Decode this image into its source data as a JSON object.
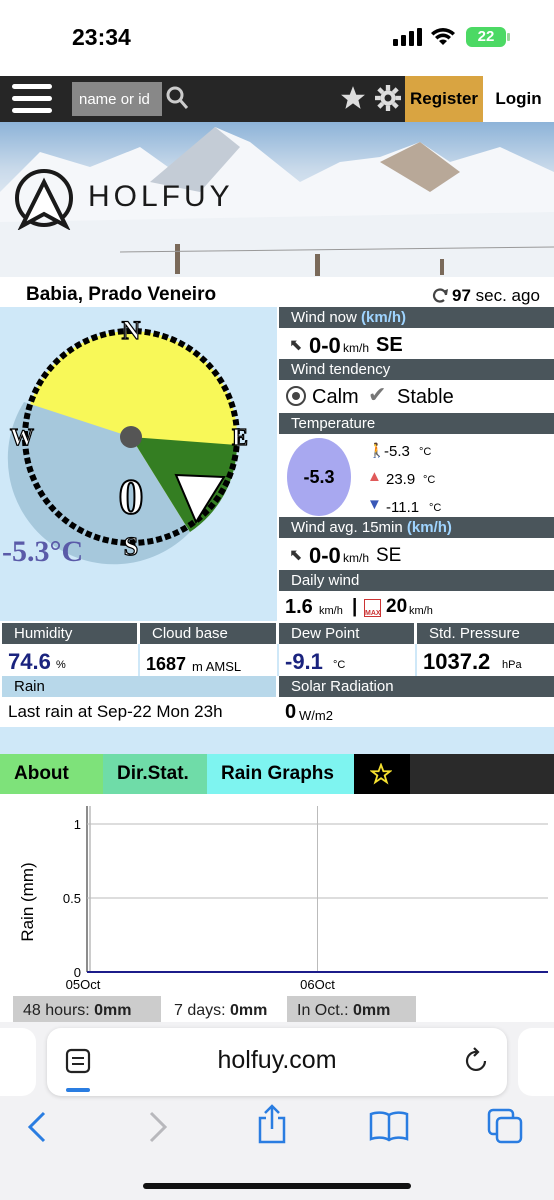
{
  "status": {
    "time": "23:34",
    "battery": "22"
  },
  "nav": {
    "search_placeholder": "name or id",
    "register_label": "Register",
    "login_label": "Login"
  },
  "banner": {
    "logo_text": "HOLFUY"
  },
  "station": {
    "name": "Babia, Prado Veneiro",
    "updated_value": "97",
    "updated_suffix": " sec. ago"
  },
  "compass": {
    "n": "N",
    "s": "S",
    "e": "E",
    "w": "W",
    "wind_value": "0",
    "temperature": "-5.3°C"
  },
  "wind_now": {
    "header": "Wind now ",
    "unit": "(km/h)",
    "value": "0-0",
    "unit_small": "km/h",
    "direction": "SE"
  },
  "wind_tendency": {
    "header": "Wind tendency",
    "calm_label": "Calm",
    "stable_label": "Stable"
  },
  "temperature": {
    "header": "Temperature",
    "current": "-5.3",
    "feels": "-5.3",
    "max": "23.9",
    "min": "-11.1",
    "unit": "°C"
  },
  "wind_avg": {
    "header": "Wind avg. 15min ",
    "unit": "(km/h)",
    "value": "0-0",
    "unit_small": "km/h",
    "direction": "SE"
  },
  "daily_wind": {
    "header": "Daily wind",
    "avg_value": "1.6",
    "avg_unit": "km/h",
    "separator": "|",
    "max_value": "20",
    "max_unit": "km/h",
    "max_badge": "MAX"
  },
  "humidity": {
    "header": "Humidity",
    "value": "74.6",
    "unit": "%"
  },
  "cloud_base": {
    "header": "Cloud base",
    "value": "1687",
    "unit": "m AMSL"
  },
  "dew_point": {
    "header": "Dew Point",
    "value": "-9.1",
    "unit": "°C"
  },
  "pressure": {
    "header": "Std. Pressure",
    "value": "1037.2",
    "unit": "hPa"
  },
  "rain": {
    "header": "Rain",
    "text": "Last rain at Sep-22 Mon 23h"
  },
  "solar": {
    "header": "Solar Radiation",
    "value": "0",
    "unit": "W/m2"
  },
  "tabs": {
    "about": "About",
    "dir_stat": "Dir.Stat.",
    "rain_graphs": "Rain Graphs"
  },
  "summary": {
    "h48_label": "48 hours: ",
    "h48_value": "0mm",
    "d7_label": "7 days: ",
    "d7_value": "0mm",
    "oct_label": "In Oct.: ",
    "oct_value": "0mm"
  },
  "safari": {
    "url": "holfuy.com"
  },
  "colors": {
    "compass_fill": "#f8f858",
    "compass_sector": "#a6c8dc",
    "compass_green": "#347e22",
    "temp_bubble": "#a8a8f0",
    "accent_register": "#d9a441",
    "tab_about": "#7ee27a",
    "tab_dirstat": "#6fdca8",
    "tab_rain": "#7ef4f0",
    "tab_star": "#000000"
  },
  "chart_data": {
    "type": "line",
    "ylabel": "Rain (mm)",
    "xlabel": "",
    "ylim": [
      0,
      1
    ],
    "yticks": [
      "0",
      "0.5",
      "1"
    ],
    "xticks": [
      "05Oct",
      "06Oct"
    ],
    "series": [
      {
        "name": "",
        "x": [
          "05Oct",
          "06Oct"
        ],
        "y": [
          0,
          0
        ]
      }
    ]
  }
}
